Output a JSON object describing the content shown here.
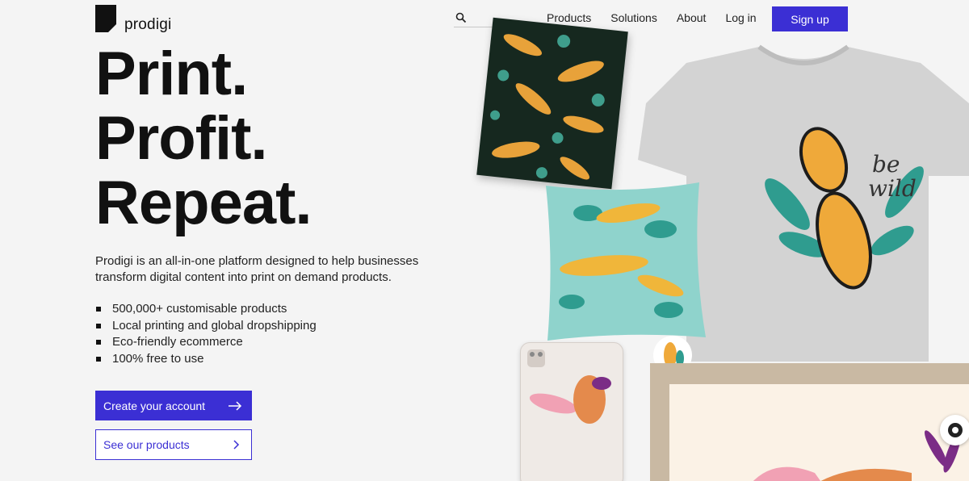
{
  "brand": {
    "name": "prodigi"
  },
  "search": {
    "value": "",
    "placeholder": ""
  },
  "nav": {
    "products": "Products",
    "solutions": "Solutions",
    "about": "About",
    "login": "Log in",
    "signup": "Sign up"
  },
  "hero": {
    "line1": "Print.",
    "line2": "Profit.",
    "line3": "Repeat.",
    "description": "Prodigi is an all-in-one platform designed to help businesses transform digital content into print on demand products.",
    "bullets": [
      "500,000+ customisable products",
      "Local printing and global dropshipping",
      "Eco-friendly ecommerce",
      "100% free to use"
    ],
    "cta_primary": "Create your account",
    "cta_secondary": "See our products"
  },
  "colors": {
    "accent": "#3b2fd4",
    "background": "#f4f4f4",
    "text": "#111111"
  },
  "tshirt_text": {
    "line1": "be",
    "line2": "wild"
  }
}
